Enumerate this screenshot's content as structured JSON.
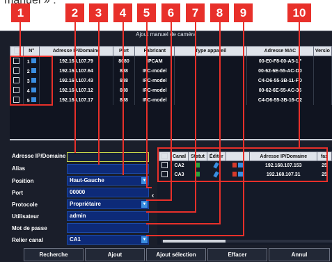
{
  "caption": "manuel » :",
  "callouts": [
    "1",
    "2",
    "3",
    "4",
    "5",
    "6",
    "7",
    "8",
    "9",
    "10"
  ],
  "dialog": {
    "title": "Ajout manuel de caméra"
  },
  "camera_table": {
    "headers": [
      "",
      "N°",
      "Adresse IP/Domaine",
      "Port",
      "Fabricant",
      "Type appareil",
      "Adresse MAC",
      "Versio"
    ],
    "rows": [
      {
        "n": "1",
        "ip": "192.168.107.79",
        "port": "8080",
        "maker": "IPCAM",
        "mac": "00-E0-F8-00-A5-1F"
      },
      {
        "n": "2",
        "ip": "192.168.107.64",
        "port": "888",
        "maker": "IPC-model",
        "mac": "00-62-6E-55-AC-D0"
      },
      {
        "n": "3",
        "ip": "192.168.107.43",
        "port": "888",
        "maker": "IPC-model",
        "mac": "C4-D6-55-3B-11-FD"
      },
      {
        "n": "4",
        "ip": "192.168.107.12",
        "port": "888",
        "maker": "IPC-model",
        "mac": "00-62-6E-55-AC-35"
      },
      {
        "n": "5",
        "ip": "192.168.107.17",
        "port": "888",
        "maker": "IPC-model",
        "mac": "C4-D6-55-3B-16-C2"
      }
    ]
  },
  "form": {
    "ip_label": "Adresse IP/Domaine",
    "ip_value": "",
    "alias_label": "Alias",
    "alias_value": "",
    "position_label": "Position",
    "position_value": "Haut-Gauche",
    "port_label": "Port",
    "port_value": "00000",
    "protocol_label": "Protocole",
    "protocol_value": "Propriétaire",
    "user_label": "Utilisateur",
    "user_value": "admin",
    "password_label": "Mot de passe",
    "password_value": "",
    "channel_label": "Relier canal",
    "channel_value": "CA1"
  },
  "channel_table": {
    "headers": [
      "",
      "Canal",
      "Statut",
      "Éditer",
      "",
      "Adresse IP/Domaine",
      "fas"
    ],
    "rows": [
      {
        "canal": "CA2",
        "ip": "192.168.107.153",
        "extra": "25"
      },
      {
        "canal": "CA3",
        "ip": "192.168.107.31",
        "extra": "25"
      }
    ]
  },
  "buttons": {
    "search": "Recherche",
    "add": "Ajout",
    "add_selection": "Ajout sélection",
    "delete": "Effacer",
    "cancel": "Annul"
  },
  "colors": {
    "callout": "#e8302a",
    "field_blue": "#0d2a78",
    "accent_blue": "#3a8ee0"
  }
}
